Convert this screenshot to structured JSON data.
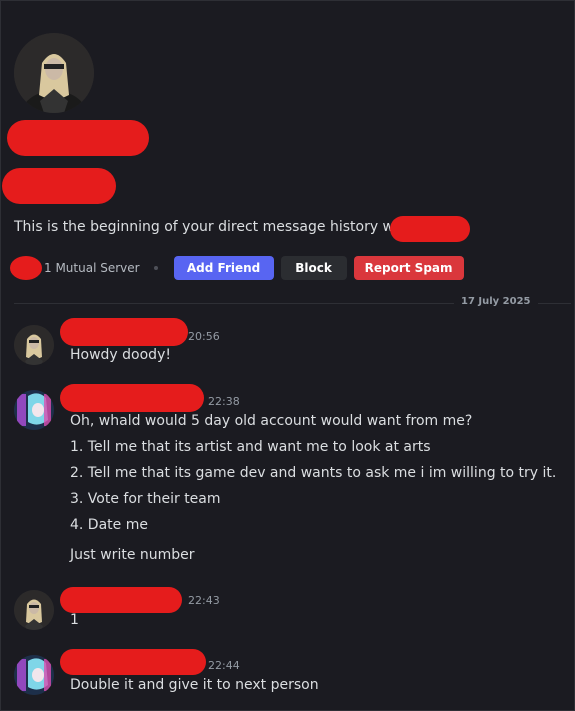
{
  "profile": {
    "intro_text": "This is the beginning of your direct message history with",
    "mutual_servers": "1 Mutual Server",
    "buttons": {
      "add_friend": "Add Friend",
      "block": "Block",
      "report_spam": "Report Spam"
    }
  },
  "divider": {
    "date": "17 July 2025"
  },
  "messages": [
    {
      "time": "20:56",
      "lines": [
        "Howdy doody!"
      ]
    },
    {
      "time": "22:38",
      "lines": [
        "Oh, whald would 5 day old account would want from me?",
        "1. Tell me that its artist and want me to look at arts",
        "2. Tell me that its game dev and wants to ask me i im willing to try it.",
        "3. Vote for their team",
        "4. Date me",
        "Just write number"
      ]
    },
    {
      "time": "22:43",
      "lines": [
        "1"
      ]
    },
    {
      "time": "22:44",
      "lines": [
        "Double it and give it to next person"
      ]
    }
  ],
  "colors": {
    "background": "#1b1b21",
    "redaction": "#e51c1c",
    "add_friend": "#5865f2",
    "report_spam": "#da373c"
  }
}
